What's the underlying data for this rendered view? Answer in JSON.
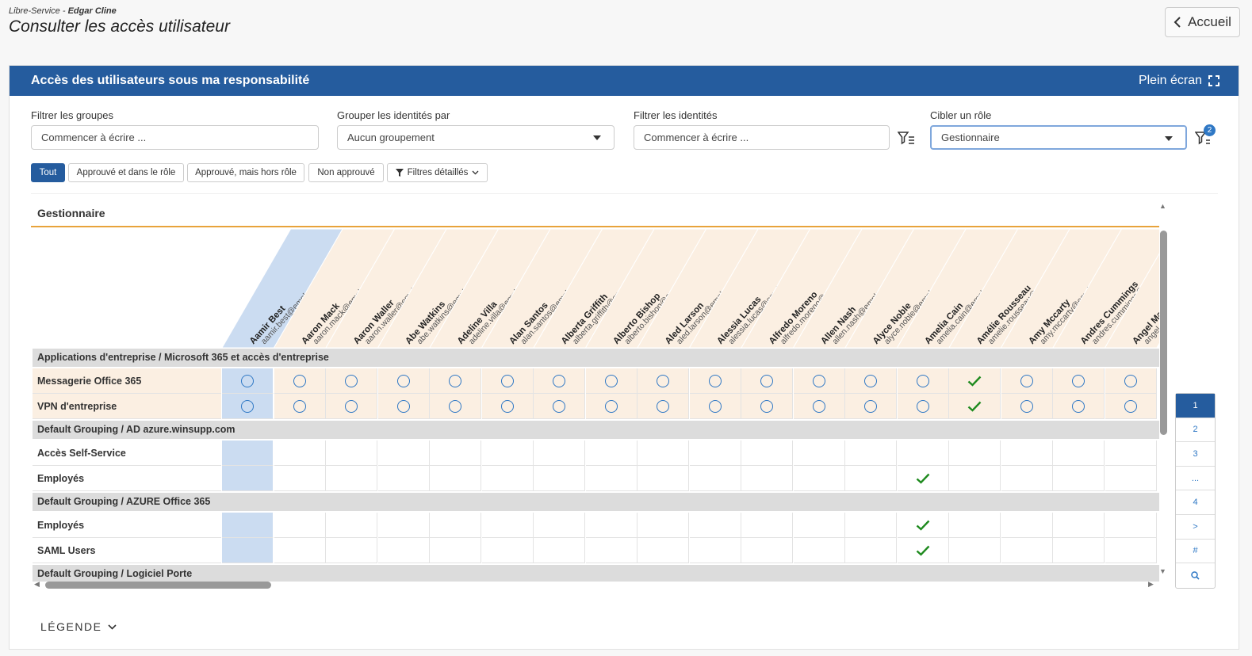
{
  "breadcrumb": {
    "app": "Libre-Service",
    "separator": " - ",
    "user": "Edgar Cline"
  },
  "page_title": "Consulter les accès utilisateur",
  "home_button": "Accueil",
  "panel": {
    "title": "Accès des utilisateurs sous ma responsabilité",
    "fullscreen_label": "Plein écran"
  },
  "filters": {
    "groups_label": "Filtrer les groupes",
    "groups_placeholder": "Commencer à écrire ...",
    "groupby_label": "Grouper les identités par",
    "groupby_value": "Aucun groupement",
    "identities_label": "Filtrer les identités",
    "identities_placeholder": "Commencer à écrire ...",
    "role_label": "Cibler un rôle",
    "role_value": "Gestionnaire",
    "filter_badge": "2"
  },
  "chips": {
    "all": "Tout",
    "approved_in_role": "Approuvé et dans le rôle",
    "approved_out_role": "Approuvé, mais hors rôle",
    "not_approved": "Non approuvé",
    "detailed": "Filtres détaillés"
  },
  "matrix": {
    "title": "Gestionnaire",
    "identities": [
      {
        "name": "Aamir Best",
        "email": "aamir.best@employes.example"
      },
      {
        "name": "Aaron Mack",
        "email": "aaron.mack@employes.example"
      },
      {
        "name": "Aaron Waller",
        "email": "aaron.waller@employes.example"
      },
      {
        "name": "Abe Watkins",
        "email": "abe.watkins@employes.example"
      },
      {
        "name": "Adeline Villa",
        "email": "adeline.villa@employes.example"
      },
      {
        "name": "Alan Santos",
        "email": "alan.santos@employes.example"
      },
      {
        "name": "Alberta Griffith",
        "email": "alberta.griffith@employes.exam..."
      },
      {
        "name": "Alberto Bishop",
        "email": "alberto.bishop@employes.exam..."
      },
      {
        "name": "Aled Larson",
        "email": "aled.larson@employes.example"
      },
      {
        "name": "Alessia Lucas",
        "email": "alessia.lucas@employes.example"
      },
      {
        "name": "Alfredo Moreno",
        "email": "alfredo.moreno@employes.exa..."
      },
      {
        "name": "Allen Nash",
        "email": "allen.nash@employes.example"
      },
      {
        "name": "Alyce Noble",
        "email": "alyce.noble@employes.example"
      },
      {
        "name": "Amelia Cain",
        "email": "amelia.cain@employes.example"
      },
      {
        "name": "Amélie Rousseau",
        "email": "amelie.rousseau@employes.exa..."
      },
      {
        "name": "Amy Mccarty",
        "email": "amy.mccarty@employes.example"
      },
      {
        "name": "Andres Cummings",
        "email": "andres.cummings@employes.exa..."
      },
      {
        "name": "Angel Ma...",
        "email": "angel..."
      }
    ],
    "sections": [
      {
        "title": "Applications d'entreprise / Microsoft 365 et accès d'entreprise",
        "rows": [
          {
            "label": "Messagerie Office 365",
            "highlight": true,
            "cells": [
              "o",
              "o",
              "o",
              "o",
              "o",
              "o",
              "o",
              "o",
              "o",
              "o",
              "o",
              "o",
              "o",
              "o",
              "v",
              "o",
              "o",
              "o"
            ]
          },
          {
            "label": "VPN d'entreprise",
            "highlight": true,
            "cells": [
              "o",
              "o",
              "o",
              "o",
              "o",
              "o",
              "o",
              "o",
              "o",
              "o",
              "o",
              "o",
              "o",
              "o",
              "v",
              "o",
              "o",
              "o"
            ]
          }
        ]
      },
      {
        "title": "Default Grouping / AD azure.winsupp.com",
        "rows": [
          {
            "label": "Accès Self-Service",
            "highlight": false,
            "cells": [
              "",
              "",
              "",
              "",
              "",
              "",
              "",
              "",
              "",
              "",
              "",
              "",
              "",
              "",
              "",
              "",
              "",
              ""
            ]
          },
          {
            "label": "Employés",
            "highlight": false,
            "cells": [
              "",
              "",
              "",
              "",
              "",
              "",
              "",
              "",
              "",
              "",
              "",
              "",
              "",
              "v",
              "",
              "",
              "",
              ""
            ]
          }
        ]
      },
      {
        "title": "Default Grouping / AZURE Office 365",
        "rows": [
          {
            "label": "Employés",
            "highlight": false,
            "cells": [
              "",
              "",
              "",
              "",
              "",
              "",
              "",
              "",
              "",
              "",
              "",
              "",
              "",
              "v",
              "",
              "",
              "",
              ""
            ]
          },
          {
            "label": "SAML Users",
            "highlight": false,
            "cells": [
              "",
              "",
              "",
              "",
              "",
              "",
              "",
              "",
              "",
              "",
              "",
              "",
              "",
              "v",
              "",
              "",
              "",
              ""
            ]
          }
        ]
      },
      {
        "title": "Default Grouping / Logiciel Porte",
        "rows": []
      }
    ]
  },
  "pager": [
    "1",
    "2",
    "3",
    "...",
    "4",
    ">",
    "#",
    "search-icon"
  ],
  "legend_label": "LÉGENDE",
  "colors": {
    "primary": "#255c9e",
    "accent_line": "#e8a33b",
    "check": "#1e8a1e",
    "circle": "#2f78c5",
    "highlight_row": "#fbefe2",
    "selected_col": "#cbdcf1"
  }
}
